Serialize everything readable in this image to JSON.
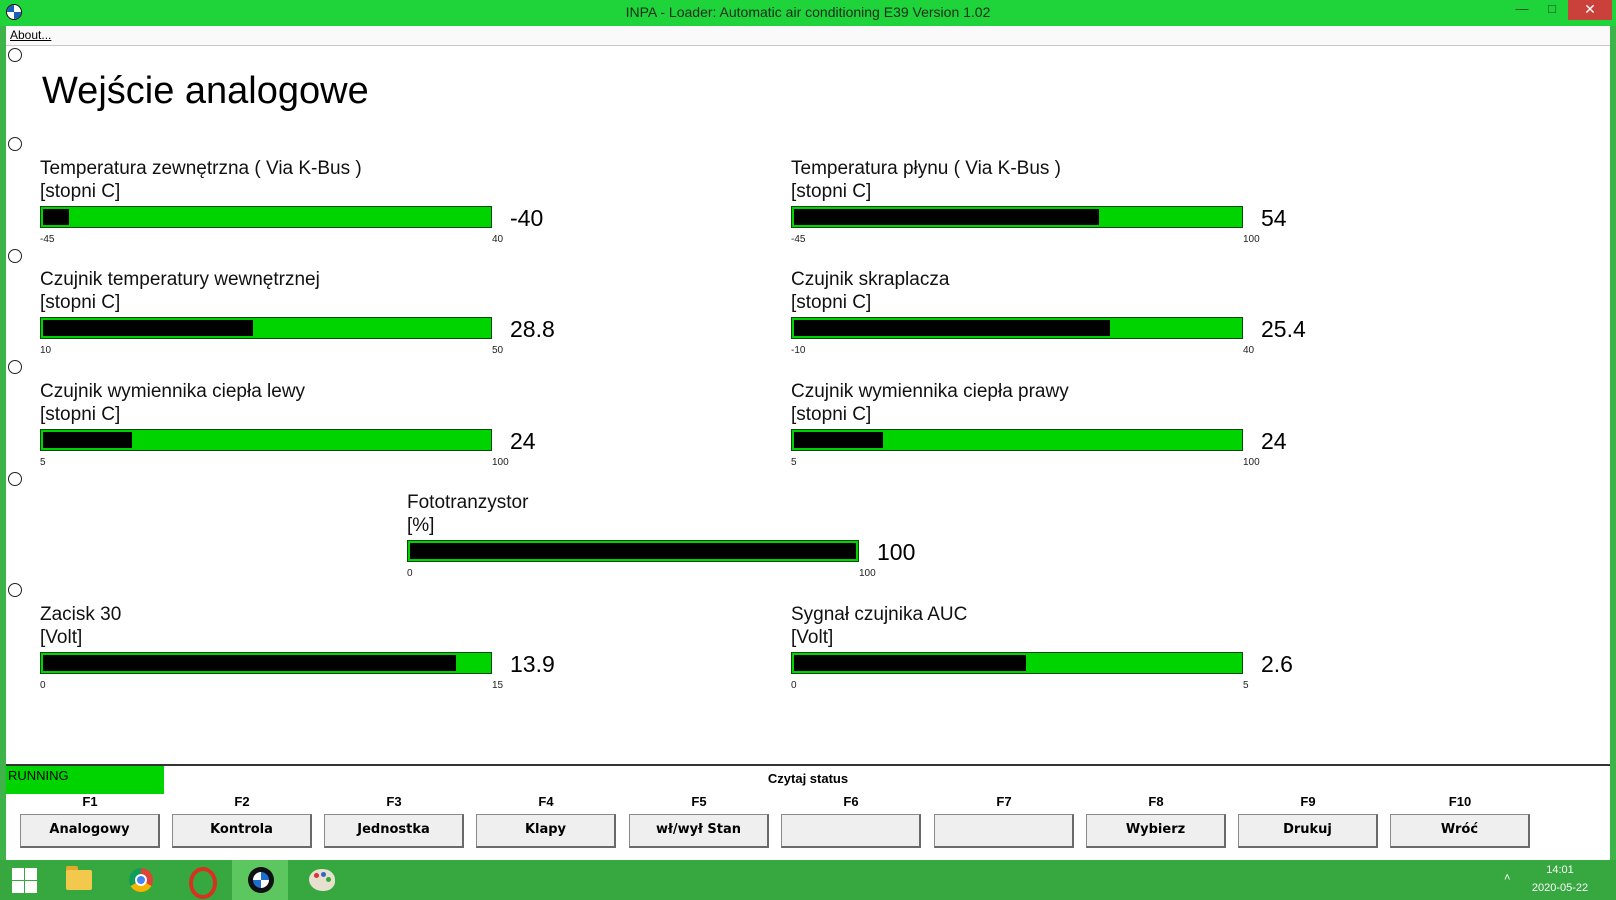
{
  "window": {
    "title": "INPA - Loader:  Automatic air conditioning E39 Version 1.02",
    "min_glyph": "—",
    "max_glyph": "□",
    "close_glyph": "✕"
  },
  "menu": {
    "about": "About..."
  },
  "screen": {
    "title": "Wejście analogowe"
  },
  "gauges": [
    {
      "label": "Temperatura zewnętrzna ( Via K-Bus )",
      "unit": "[stopni C]",
      "min": "-45",
      "max": "40",
      "value": "-40",
      "value_num": -40,
      "min_num": -45,
      "max_num": 40
    },
    {
      "label": "Temperatura płynu ( Via K-Bus )",
      "unit": "[stopni C]",
      "min": "-45",
      "max": "100",
      "value": "54",
      "value_num": 54,
      "min_num": -45,
      "max_num": 100
    },
    {
      "label": "Czujnik temperatury wewnętrznej",
      "unit": "[stopni C]",
      "min": "10",
      "max": "50",
      "value": "28.8",
      "value_num": 28.8,
      "min_num": 10,
      "max_num": 50
    },
    {
      "label": "Czujnik skraplacza",
      "unit": "[stopni C]",
      "min": "-10",
      "max": "40",
      "value": "25.4",
      "value_num": 25.4,
      "min_num": -10,
      "max_num": 40
    },
    {
      "label": "Czujnik wymiennika ciepła lewy",
      "unit": "[stopni C]",
      "min": "5",
      "max": "100",
      "value": "24",
      "value_num": 24,
      "min_num": 5,
      "max_num": 100
    },
    {
      "label": "Czujnik wymiennika ciepła prawy",
      "unit": "[stopni C]",
      "min": "5",
      "max": "100",
      "value": "24",
      "value_num": 24,
      "min_num": 5,
      "max_num": 100
    },
    {
      "label": "Fototranzystor",
      "unit": "[%]",
      "min": "0",
      "max": "100",
      "value": "100",
      "value_num": 100,
      "min_num": 0,
      "max_num": 100
    },
    {
      "label": "Zacisk 30",
      "unit": "[Volt]",
      "min": "0",
      "max": "15",
      "value": "13.9",
      "value_num": 13.9,
      "min_num": 0,
      "max_num": 15
    },
    {
      "label": "Sygnał czujnika AUC",
      "unit": "[Volt]",
      "min": "0",
      "max": "5",
      "value": "2.6",
      "value_num": 2.6,
      "min_num": 0,
      "max_num": 5
    }
  ],
  "status": {
    "running": "RUNNING",
    "caption": "Czytaj status"
  },
  "fkeys": [
    {
      "key": "F1",
      "label": "Analogowy"
    },
    {
      "key": "F2",
      "label": "Kontrola"
    },
    {
      "key": "F3",
      "label": "Jednostka"
    },
    {
      "key": "F4",
      "label": "Klapy"
    },
    {
      "key": "F5",
      "label": "wł/wył Stan"
    },
    {
      "key": "F6",
      "label": ""
    },
    {
      "key": "F7",
      "label": ""
    },
    {
      "key": "F8",
      "label": "Wybierz"
    },
    {
      "key": "F9",
      "label": "Drukuj"
    },
    {
      "key": "F10",
      "label": "Wróć"
    }
  ],
  "taskbar": {
    "icons": [
      "windows-start-icon",
      "file-explorer-icon",
      "chrome-icon",
      "opera-icon",
      "bmw-inpa-icon",
      "paint-icon"
    ],
    "tray_chevron": "˄",
    "time": "14:01",
    "date": "2020-05-22"
  },
  "colors": {
    "bar_green": "#00d400",
    "bar_fill": "#000000",
    "window_green": "#1fd43a"
  }
}
